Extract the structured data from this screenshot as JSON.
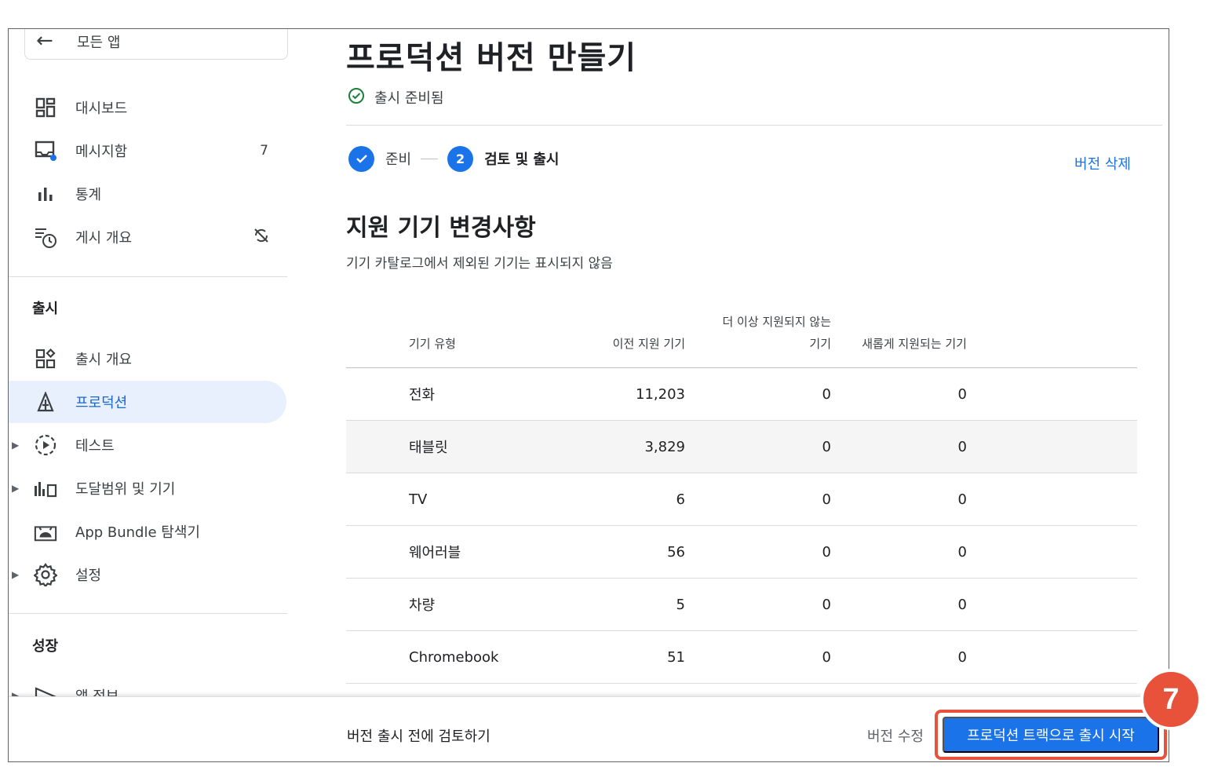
{
  "sidebar": {
    "back_label": "모든 앱",
    "items_top": [
      {
        "label": "대시보드",
        "badge": ""
      },
      {
        "label": "메시지함",
        "badge": "7"
      },
      {
        "label": "통계",
        "badge": ""
      },
      {
        "label": "게시 개요",
        "badge": ""
      }
    ],
    "release_heading": "출시",
    "release_items": [
      {
        "label": "출시 개요"
      },
      {
        "label": "프로덕션"
      },
      {
        "label": "테스트"
      },
      {
        "label": "도달범위 및 기기"
      },
      {
        "label": "App Bundle 탐색기"
      },
      {
        "label": "설정"
      }
    ],
    "growth_heading": "성장",
    "growth_items": [
      {
        "label": "앱 정보"
      }
    ]
  },
  "main": {
    "title": "프로덕션 버전 만들기",
    "status": "출시 준비됨",
    "steps": [
      {
        "number": "",
        "label": "준비"
      },
      {
        "number": "2",
        "label": "검토 및 출시"
      }
    ],
    "delete_link": "버전 삭제",
    "section_title": "지원 기기 변경사항",
    "section_subtitle": "기기 카탈로그에서 제외된 기기는 표시되지 않음",
    "table": {
      "headers": [
        "기기 유형",
        "이전 지원 기기",
        "더 이상 지원되지 않는",
        "기기",
        "새롭게 지원되는 기기"
      ],
      "rows": [
        {
          "type": "전화",
          "previous": "11,203",
          "removed": "0",
          "added": "0"
        },
        {
          "type": "태블릿",
          "previous": "3,829",
          "removed": "0",
          "added": "0"
        },
        {
          "type": "TV",
          "previous": "6",
          "removed": "0",
          "added": "0"
        },
        {
          "type": "웨어러블",
          "previous": "56",
          "removed": "0",
          "added": "0"
        },
        {
          "type": "차량",
          "previous": "5",
          "removed": "0",
          "added": "0"
        },
        {
          "type": "Chromebook",
          "previous": "51",
          "removed": "0",
          "added": "0"
        }
      ]
    }
  },
  "footer": {
    "text": "버전 출시 전에 검토하기",
    "edit_label": "버전 수정",
    "cta_label": "프로덕션 트랙으로 출시 시작"
  },
  "annotation": {
    "step_number": "7"
  },
  "colors": {
    "accent": "#1a73e8",
    "active_bg": "#e8f0fe",
    "success": "#188038",
    "callout": "#e8513a"
  }
}
